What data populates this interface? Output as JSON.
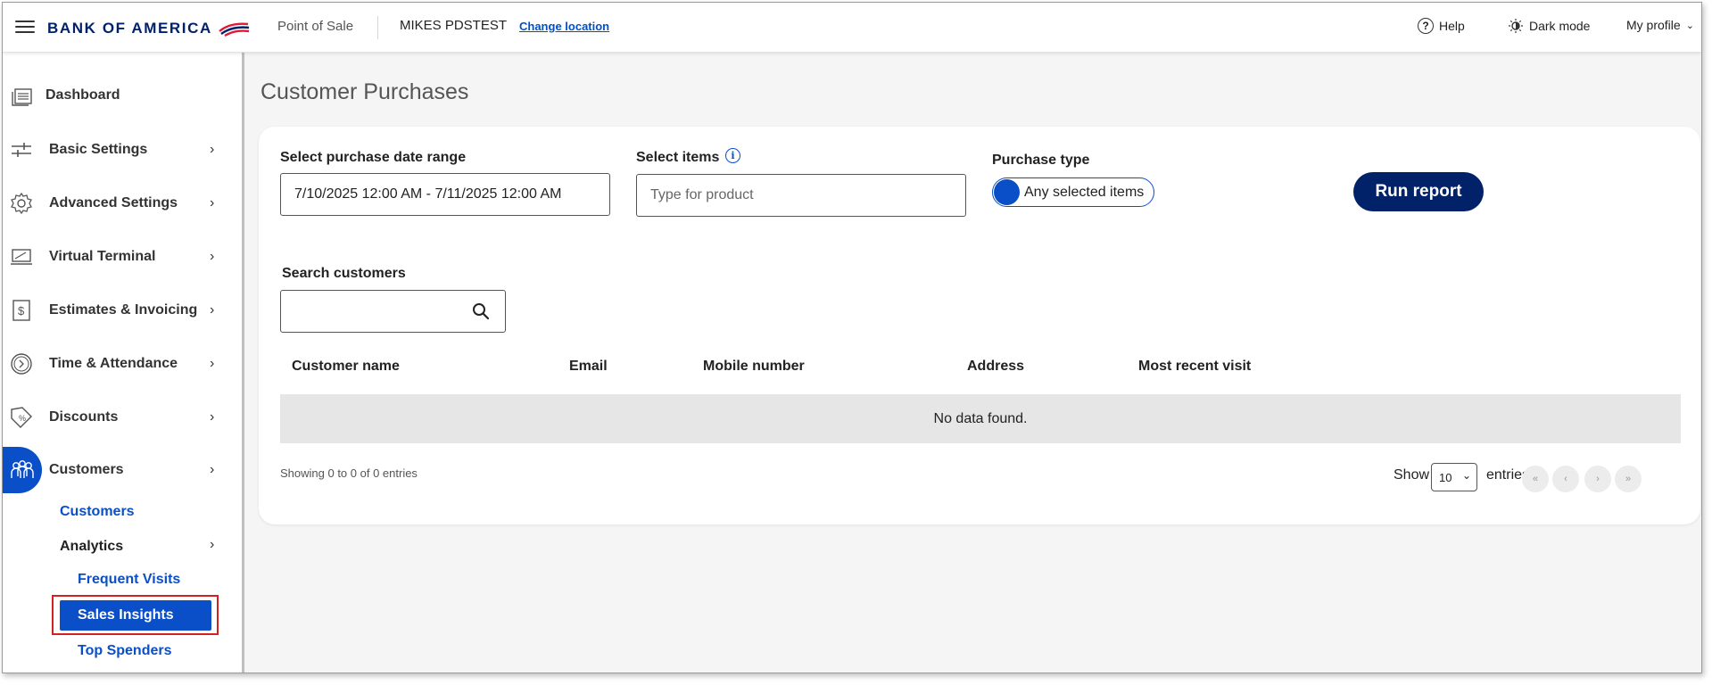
{
  "header": {
    "brand": "BANK OF AMERICA",
    "app_name": "Point of Sale",
    "location": "MIKES PDSTEST",
    "change_location": "Change location",
    "help": "Help",
    "dark_mode": "Dark mode",
    "profile": "My profile"
  },
  "sidebar": {
    "items": [
      {
        "label": "Dashboard",
        "icon": "dashboard-icon"
      },
      {
        "label": "Basic Settings",
        "icon": "sliders-icon"
      },
      {
        "label": "Advanced Settings",
        "icon": "gear-icon"
      },
      {
        "label": "Virtual Terminal",
        "icon": "laptop-icon"
      },
      {
        "label": "Estimates & Invoicing",
        "icon": "invoice-icon"
      },
      {
        "label": "Time & Attendance",
        "icon": "clock-icon"
      },
      {
        "label": "Discounts",
        "icon": "tag-icon"
      },
      {
        "label": "Customers",
        "icon": "people-icon"
      }
    ],
    "sub": {
      "customers": "Customers",
      "analytics": "Analytics",
      "frequent_visits": "Frequent Visits",
      "sales_insights": "Sales Insights",
      "top_spenders": "Top Spenders"
    },
    "active_color": "#0a4fc7"
  },
  "main": {
    "title": "Customer Purchases",
    "date_range_label": "Select purchase date range",
    "date_range_value": "7/10/2025 12:00 AM - 7/11/2025 12:00 AM",
    "items_label": "Select items",
    "items_placeholder": "Type for product",
    "purchase_type_label": "Purchase type",
    "purchase_type_value": "Any selected items",
    "run_report": "Run report",
    "search_label": "Search customers",
    "search_value": "",
    "table": {
      "columns": [
        "Customer name",
        "Email",
        "Mobile number",
        "Address",
        "Most recent visit"
      ],
      "empty_message": "No data found."
    },
    "showing": "Showing 0 to 0 of 0 entries",
    "show": "Show",
    "page_size": "10",
    "entries": "entries",
    "pagination": [
      "«",
      "‹",
      "›",
      "»"
    ]
  },
  "colors": {
    "brand_navy": "#012169",
    "accent_blue": "#0a4fc7",
    "highlight_red": "#d32020"
  }
}
